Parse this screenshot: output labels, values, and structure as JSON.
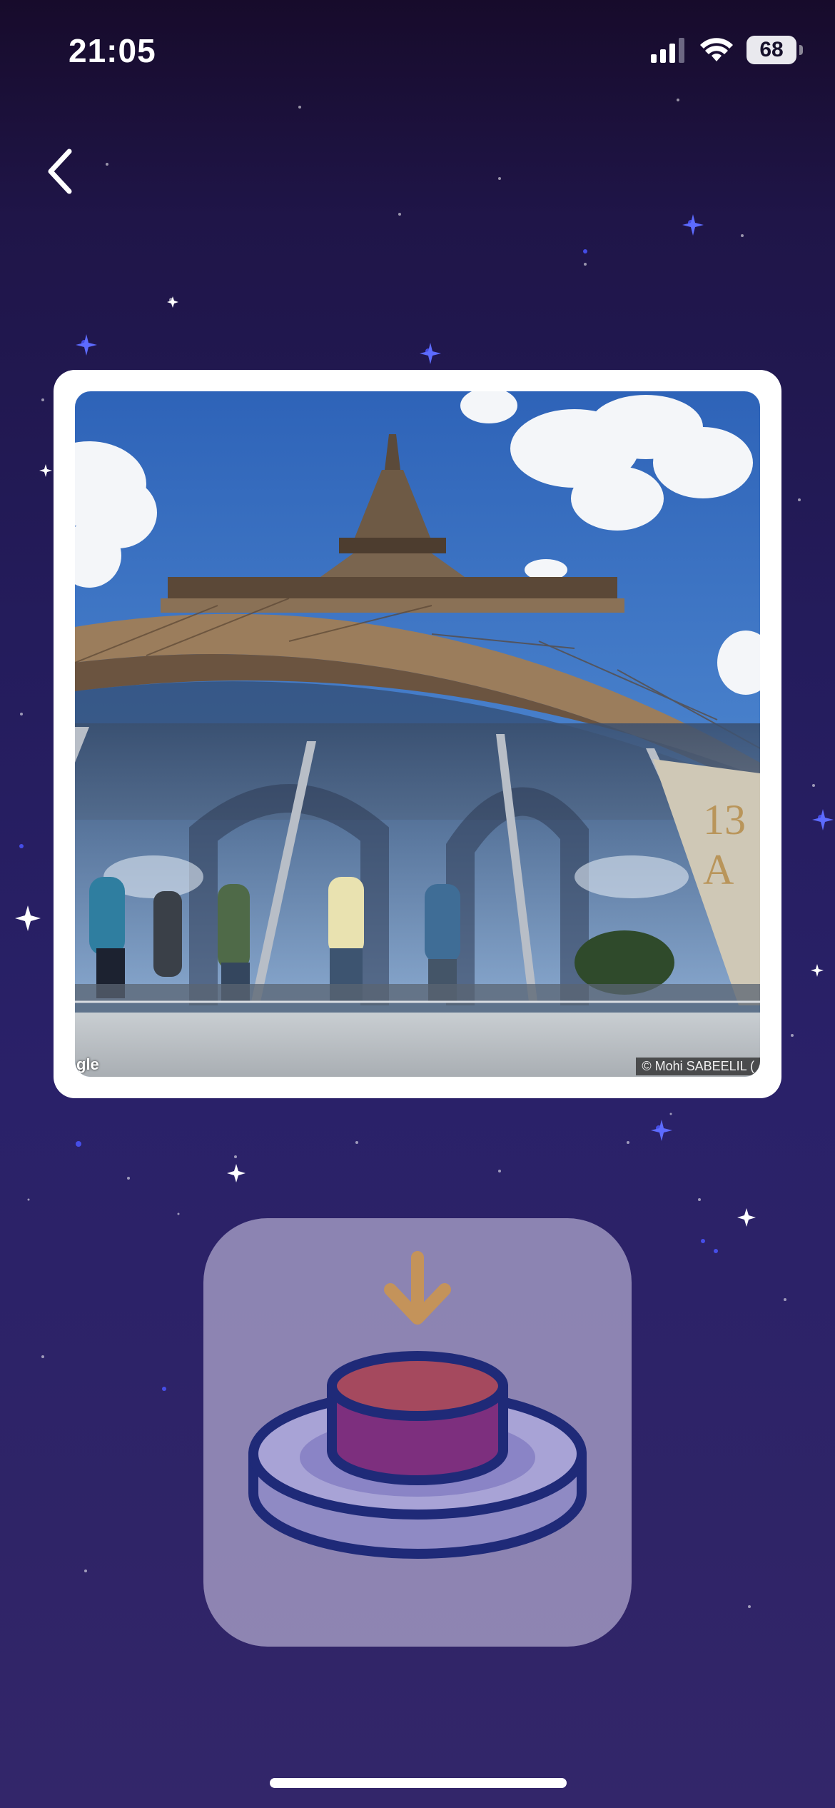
{
  "status_bar": {
    "time": "21:05",
    "battery_level": "68",
    "icons": [
      "cellular-signal-icon",
      "wifi-icon",
      "battery-icon"
    ]
  },
  "navigation": {
    "back_icon": "chevron-left-icon"
  },
  "photo_card": {
    "image_subject": "eiffel-tower-street-view-photo",
    "corner_logo": "gle",
    "credit": "© Mohi SABEELIL (",
    "sign_text": [
      "13",
      "A"
    ]
  },
  "action_button": {
    "icon": "push-buzzer-icon",
    "arrow_icon": "arrow-down-icon"
  },
  "colors": {
    "background_top": "#170b2b",
    "background_bottom": "#33266a",
    "button_background": "#a79fc6",
    "buzzer_outline": "#1f2a78",
    "buzzer_top": "#a5495e",
    "buzzer_side": "#7d2f7e",
    "arrow": "#c4935a"
  }
}
